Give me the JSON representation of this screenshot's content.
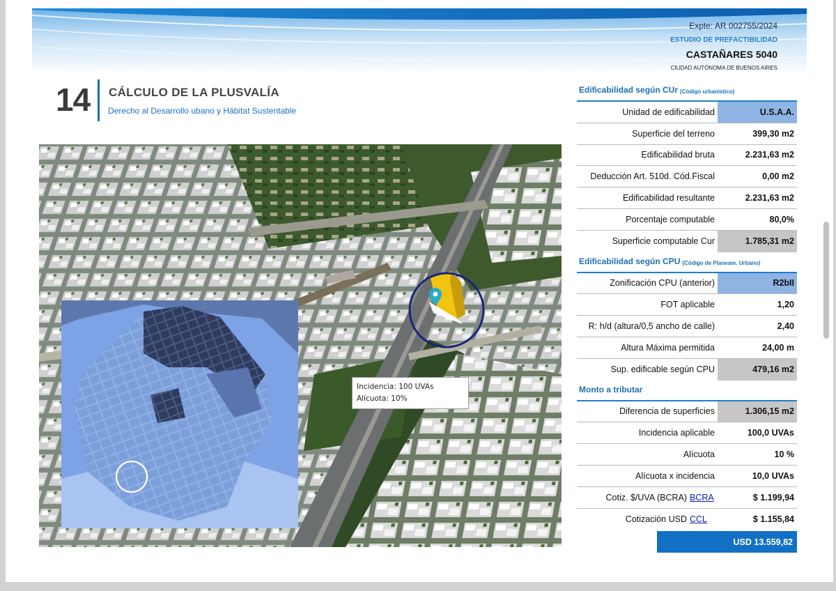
{
  "header": {
    "expediente": "Expte: AR 002755/2024",
    "estudio": "ESTUDIO DE PREFACTIBILIDAD",
    "direccion": "CASTAÑARES 5040",
    "ciudad": "CIUDAD AUTÓNOMA DE BUENOS AIRES"
  },
  "section": {
    "number": "14",
    "title": "CÁLCULO DE LA PLUSVALÍA",
    "subtitle": "Derecho al Desarrollo ubano y Hábitat Sustentable"
  },
  "callout": {
    "line1": "Incidencia: 100 UVAs",
    "line2": "Alícuota: 10%"
  },
  "table": {
    "cur": {
      "title": "Edificabilidad según CUr",
      "note": "(Código urbanístico)",
      "rows": [
        {
          "label": "Unidad de edificabilidad",
          "value": "U.S.A.A."
        },
        {
          "label": "Superficie del terreno",
          "value": "399,30 m2"
        },
        {
          "label": "Edificabilidad bruta",
          "value": "2.231,63 m2"
        },
        {
          "label": "Deducción Art. 510d. Cód.Fiscal",
          "value": "0,00 m2"
        },
        {
          "label": "Edificabilidad resultante",
          "value": "2.231,63 m2"
        },
        {
          "label": "Porcentaje computable",
          "value": "80,0%"
        },
        {
          "label": "Superficie computable Cur",
          "value": "1.785,31 m2"
        }
      ]
    },
    "cpu": {
      "title": "Edificabilidad según CPU",
      "note": "(Código de Planeam. Urbano)",
      "rows": [
        {
          "label": "Zonificación CPU (anterior)",
          "value": "R2bII"
        },
        {
          "label": "FOT aplicable",
          "value": "1,20"
        },
        {
          "label": "R: h/d (altura/0,5 ancho de calle)",
          "value": "2,40"
        },
        {
          "label": "Altura Máxima permitida",
          "value": "24,00 m"
        },
        {
          "label": "Sup. edificable según CPU",
          "value": "479,16 m2"
        }
      ]
    },
    "monto": {
      "title": "Monto a tributar",
      "rows": [
        {
          "label": "Diferencia de superficies",
          "value": "1.306,15 m2"
        },
        {
          "label": "Incidencia aplicable",
          "value": "100,0 UVAs"
        },
        {
          "label": "Alícuota",
          "value": "10 %"
        },
        {
          "label": "Alícuota x incidencia",
          "value": "10,0 UVAs"
        },
        {
          "label": "Cotiz. $/UVA (BCRA)",
          "link": "BCRA",
          "value": "$ 1.199,94"
        },
        {
          "label": "Cotización USD",
          "link": "CCL",
          "value": "$ 1.155,84"
        }
      ]
    },
    "total": "USD  13.559,82"
  },
  "colors": {
    "accent_blue": "#1e7fc9",
    "total_box": "#1271c4",
    "highlight_blue": "#8eb4e3",
    "highlight_gray": "#c6c6c6",
    "building": "#f1c40f",
    "locator_ring": "#1a237e",
    "pin": "#2aa9c9"
  },
  "icons": {
    "map_pin": "location-pin-icon"
  }
}
